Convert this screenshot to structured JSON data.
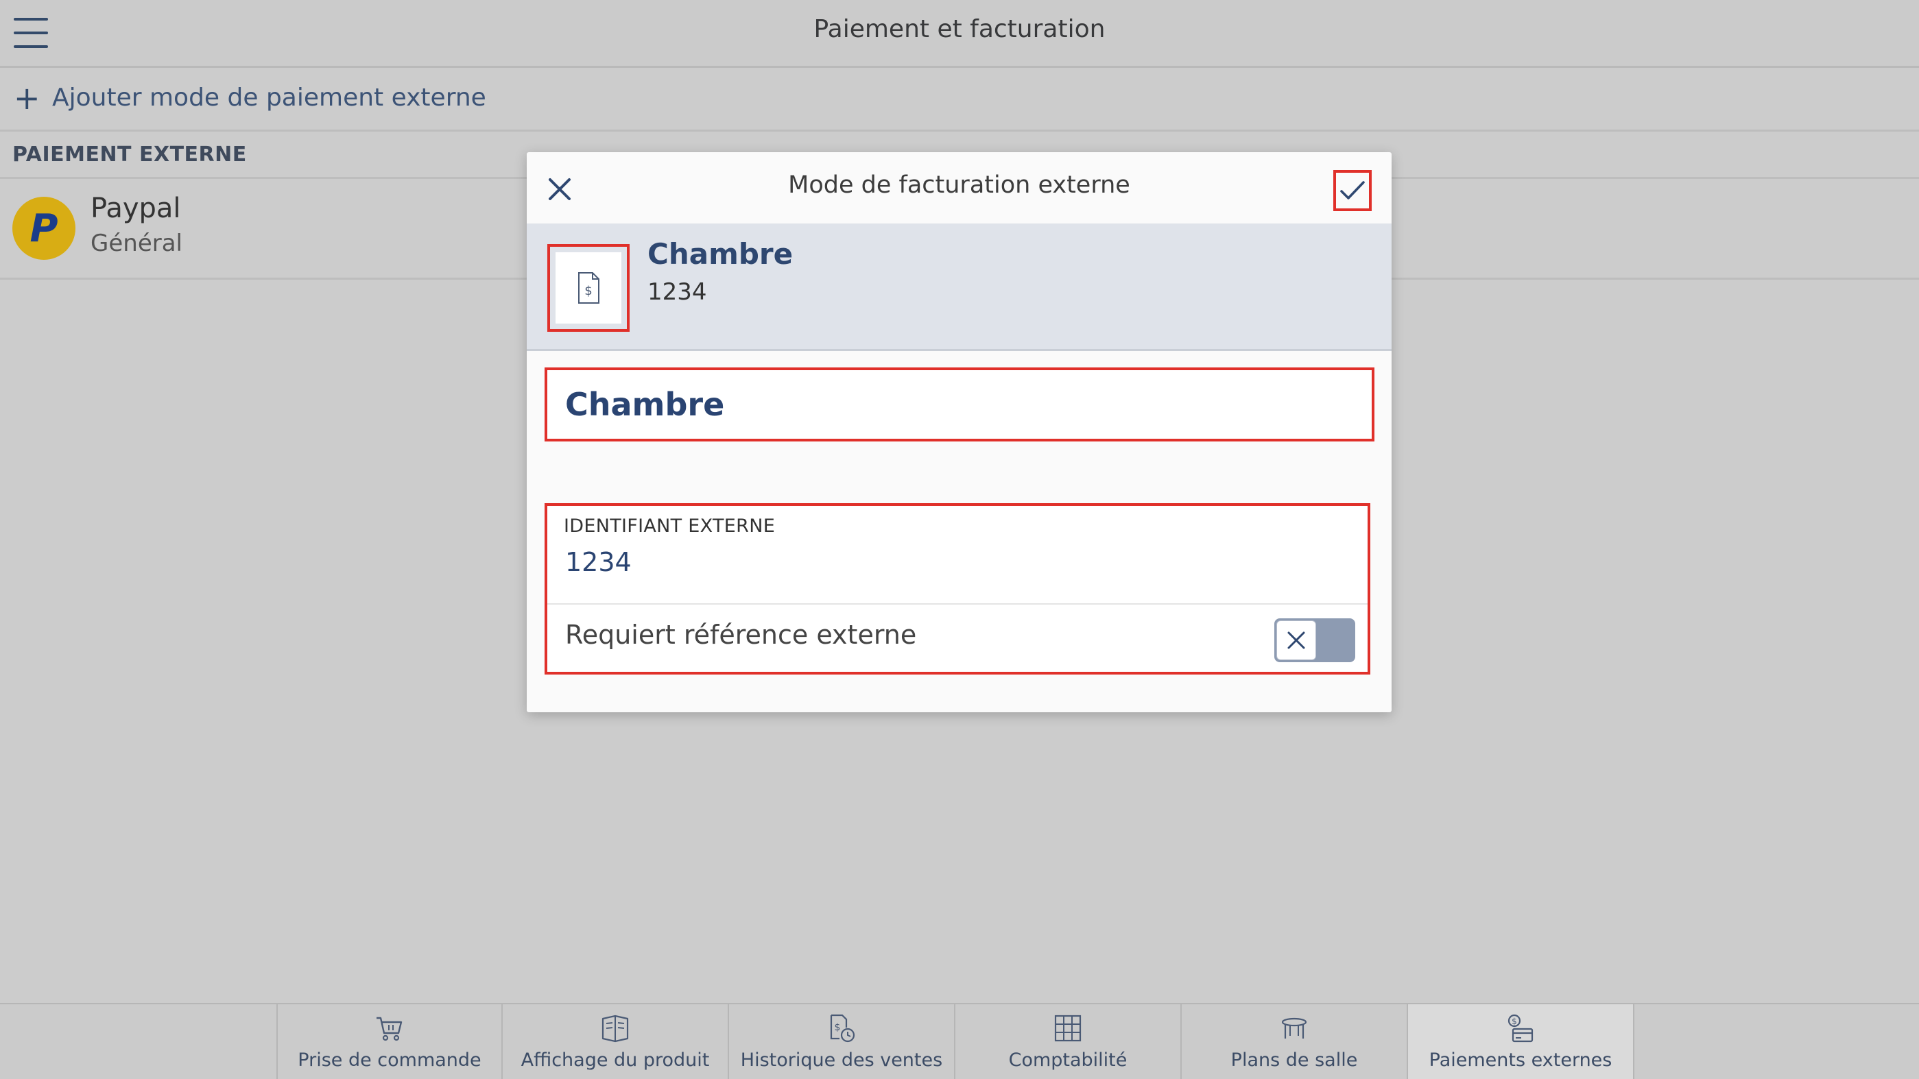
{
  "header": {
    "title": "Paiement et facturation",
    "menu_icon": "hamburger-icon"
  },
  "add_row": {
    "icon": "plus-icon",
    "label": "Ajouter mode de paiement externe"
  },
  "section": {
    "title": "PAIEMENT EXTERNE"
  },
  "list": [
    {
      "icon": "paypal-icon",
      "name": "Paypal",
      "subtitle": "Général"
    }
  ],
  "dialog": {
    "title": "Mode de facturation externe",
    "close_icon": "close-icon",
    "confirm_icon": "checkmark-icon",
    "summary": {
      "icon": "invoice-dollar-icon",
      "name": "Chambre",
      "id": "1234"
    },
    "name_field": {
      "value": "Chambre"
    },
    "external_id": {
      "label": "IDENTIFIANT EXTERNE",
      "value": "1234"
    },
    "require_reference": {
      "label": "Requiert référence externe",
      "enabled": false
    }
  },
  "tabs": [
    {
      "label": "Prise de commande",
      "icon": "cart-icon",
      "active": false
    },
    {
      "label": "Affichage du produit",
      "icon": "product-display-icon",
      "active": false
    },
    {
      "label": "Historique des ventes",
      "icon": "sales-history-icon",
      "active": false
    },
    {
      "label": "Comptabilité",
      "icon": "accounting-icon",
      "active": false
    },
    {
      "label": "Plans de salle",
      "icon": "table-icon",
      "active": false
    },
    {
      "label": "Paiements externes",
      "icon": "external-payment-icon",
      "active": true
    }
  ],
  "colors": {
    "accent": "#2a4472",
    "highlight_border": "#e0302a",
    "toggle_off": "#8d9bb2"
  }
}
